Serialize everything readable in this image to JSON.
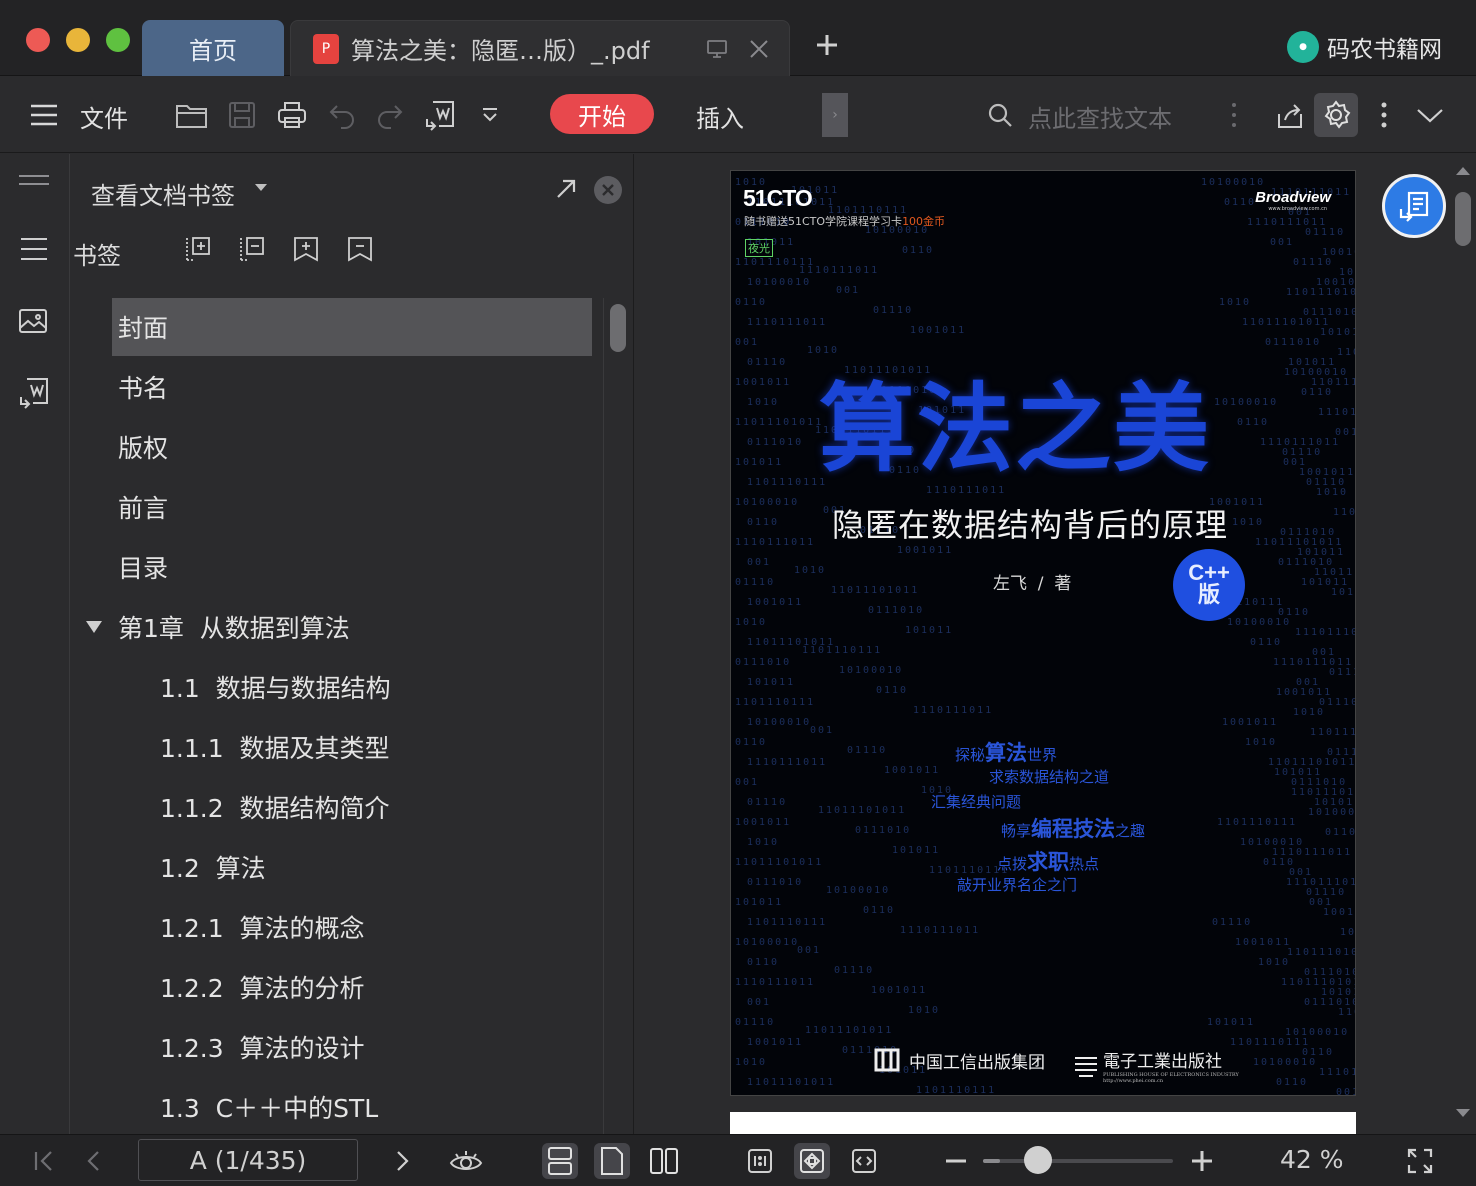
{
  "tabs": {
    "home": "首页",
    "doc_badge": "P",
    "doc_title": "算法之美：隐匿…版）_.pdf",
    "new_tab": "+"
  },
  "brand": {
    "logo_text": "码农书籍网",
    "name": "码农书籍网"
  },
  "toolbar": {
    "menu_label": "文件",
    "start_label": "开始",
    "insert_label": "插入",
    "search_placeholder": "点此查找文本",
    "icons": [
      "menu-icon",
      "open-folder-icon",
      "save-icon",
      "print-icon",
      "undo-icon",
      "redo-icon",
      "convert-icon",
      "dropdown-icon",
      "search-icon",
      "share-icon",
      "gear-icon",
      "more-icon",
      "chevron-down-icon"
    ]
  },
  "panel": {
    "title": "查看文档书签",
    "bookmark_label": "书签",
    "items": [
      {
        "label": "封面",
        "level": 0,
        "selected": true
      },
      {
        "label": "书名",
        "level": 0
      },
      {
        "label": "版权",
        "level": 0
      },
      {
        "label": "前言",
        "level": 0
      },
      {
        "label": "目录",
        "level": 0
      },
      {
        "label": "第1章  从数据到算法",
        "level": 0,
        "expanded": true
      },
      {
        "label": "1.1  数据与数据结构",
        "level": 1
      },
      {
        "label": "1.1.1  数据及其类型",
        "level": 1
      },
      {
        "label": "1.1.2  数据结构简介",
        "level": 1
      },
      {
        "label": "1.2  算法",
        "level": 1
      },
      {
        "label": "1.2.1  算法的概念",
        "level": 1
      },
      {
        "label": "1.2.2  算法的分析",
        "level": 1
      },
      {
        "label": "1.2.3  算法的设计",
        "level": 1
      },
      {
        "label": "1.3  C＋＋中的STL",
        "level": 1
      }
    ]
  },
  "cover": {
    "logo": "51CTO",
    "promo_prefix": "随书赠送51CTO学院课程学习卡",
    "promo_amount": "100金币",
    "night_tag": "夜光",
    "publisher_brand": "Broadview",
    "publisher_url": "www.broadview.com.cn",
    "title": "算法之美",
    "subtitle": "隐匿在数据结构背后的原理",
    "author": "左飞  /  著",
    "edition_badge_1": "C++",
    "edition_badge_2": "版",
    "taglines": [
      {
        "small_pre": "探秘",
        "big": "算法",
        "small_post": "世界"
      },
      {
        "small_pre": "求索数据结构之道",
        "big": "",
        "small_post": ""
      },
      {
        "small_pre": "汇集经典问题",
        "big": "",
        "small_post": ""
      },
      {
        "small_pre": "畅享",
        "big": "编程技法",
        "small_post": "之趣"
      },
      {
        "small_pre": "点拨",
        "big": "求职",
        "small_post": "热点"
      },
      {
        "small_pre": "敲开业界名企之门",
        "big": "",
        "small_post": ""
      }
    ],
    "publisher_1": "中国工信出版集团",
    "publisher_2": "電子工業出版社",
    "publisher_2_en": "PUBLISHING HOUSE OF ELECTRONICS INDUSTRY",
    "publisher_2_url": "http://www.phei.com.cn"
  },
  "statusbar": {
    "page_indicator": "A (1/435)",
    "zoom_percent": 42,
    "zoom_label": "42 %"
  },
  "colors": {
    "accent_red": "#e8484d",
    "home_tab": "#4c6688",
    "cover_blue": "#1a45d6",
    "float_button": "#2d7be5"
  }
}
